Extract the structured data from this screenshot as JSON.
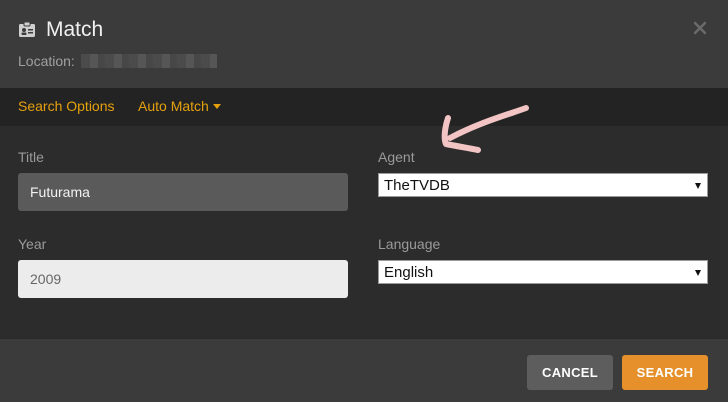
{
  "dialog": {
    "title": "Match",
    "location_label": "Location:",
    "close_icon": "close-icon",
    "title_icon": "id-card-icon"
  },
  "tabs": {
    "search_options": "Search Options",
    "auto_match": "Auto Match"
  },
  "form": {
    "title_label": "Title",
    "title_value": "Futurama",
    "year_label": "Year",
    "year_value": "2009",
    "agent_label": "Agent",
    "agent_value": "TheTVDB",
    "language_label": "Language",
    "language_value": "English"
  },
  "buttons": {
    "cancel": "CANCEL",
    "search": "SEARCH"
  },
  "colors": {
    "accent": "#e5a00d",
    "search_button": "#e5902a",
    "annotation_arrow": "#f2c4c4"
  }
}
